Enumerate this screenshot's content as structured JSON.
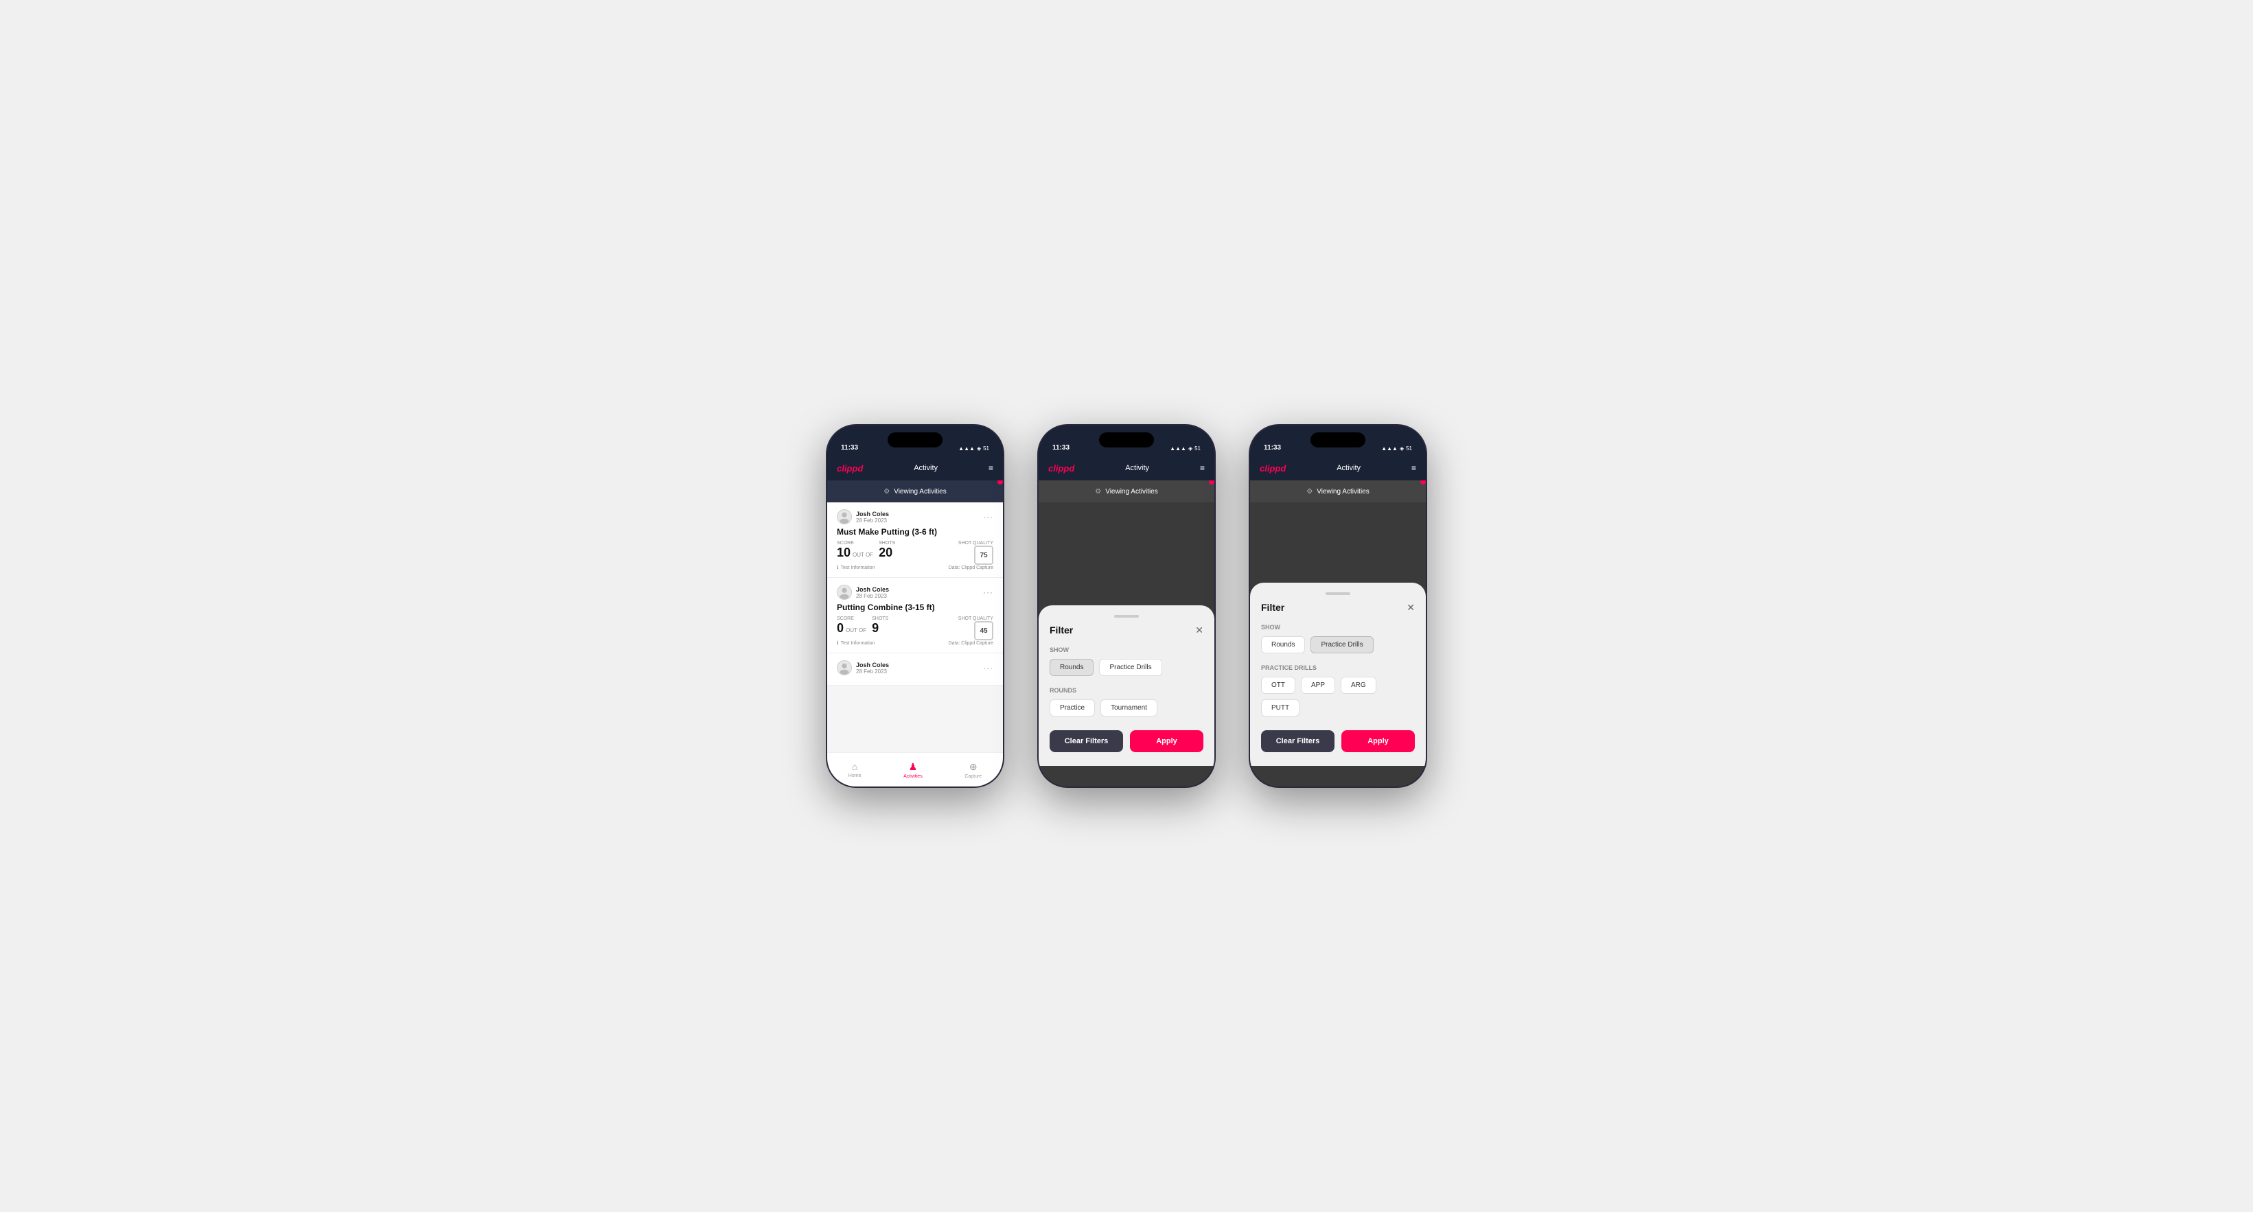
{
  "phones": [
    {
      "id": "phone1",
      "statusBar": {
        "time": "11:33",
        "battery": "51",
        "icons": "▲ ▼ ▲"
      },
      "header": {
        "logo": "clippd",
        "title": "Activity",
        "menuIcon": "≡"
      },
      "banner": {
        "icon": "⚙",
        "text": "Viewing Activities"
      },
      "activities": [
        {
          "userName": "Josh Coles",
          "date": "28 Feb 2023",
          "title": "Must Make Putting (3-6 ft)",
          "scoreLabel": "Score",
          "scoreValue": "10",
          "outOfLabel": "OUT OF",
          "totalShots": "20",
          "shotsLabel": "Shots",
          "shotQualityLabel": "Shot Quality",
          "shotQualityValue": "75",
          "info": "Test Information",
          "dataSource": "Data: Clippd Capture"
        },
        {
          "userName": "Josh Coles",
          "date": "28 Feb 2023",
          "title": "Putting Combine (3-15 ft)",
          "scoreLabel": "Score",
          "scoreValue": "0",
          "outOfLabel": "OUT OF",
          "totalShots": "9",
          "shotsLabel": "Shots",
          "shotQualityLabel": "Shot Quality",
          "shotQualityValue": "45",
          "info": "Test Information",
          "dataSource": "Data: Clippd Capture"
        },
        {
          "userName": "Josh Coles",
          "date": "28 Feb 2023",
          "title": "",
          "scoreLabel": "",
          "scoreValue": "",
          "outOfLabel": "",
          "totalShots": "",
          "shotsLabel": "",
          "shotQualityLabel": "",
          "shotQualityValue": "",
          "info": "",
          "dataSource": ""
        }
      ],
      "bottomNav": [
        {
          "icon": "⌂",
          "label": "Home",
          "active": false
        },
        {
          "icon": "♟",
          "label": "Activities",
          "active": true
        },
        {
          "icon": "⊕",
          "label": "Capture",
          "active": false
        }
      ]
    },
    {
      "id": "phone2",
      "statusBar": {
        "time": "11:33",
        "battery": "51"
      },
      "header": {
        "logo": "clippd",
        "title": "Activity",
        "menuIcon": "≡"
      },
      "banner": {
        "icon": "⚙",
        "text": "Viewing Activities"
      },
      "filter": {
        "title": "Filter",
        "showLabel": "Show",
        "showButtons": [
          {
            "label": "Rounds",
            "active": true
          },
          {
            "label": "Practice Drills",
            "active": false
          }
        ],
        "roundsLabel": "Rounds",
        "roundsButtons": [
          {
            "label": "Practice",
            "active": false
          },
          {
            "label": "Tournament",
            "active": false
          }
        ],
        "clearLabel": "Clear Filters",
        "applyLabel": "Apply"
      }
    },
    {
      "id": "phone3",
      "statusBar": {
        "time": "11:33",
        "battery": "51"
      },
      "header": {
        "logo": "clippd",
        "title": "Activity",
        "menuIcon": "≡"
      },
      "banner": {
        "icon": "⚙",
        "text": "Viewing Activities"
      },
      "filter": {
        "title": "Filter",
        "showLabel": "Show",
        "showButtons": [
          {
            "label": "Rounds",
            "active": false
          },
          {
            "label": "Practice Drills",
            "active": true
          }
        ],
        "practiceLabel": "Practice Drills",
        "practiceButtons": [
          {
            "label": "OTT",
            "active": false
          },
          {
            "label": "APP",
            "active": false
          },
          {
            "label": "ARG",
            "active": false
          },
          {
            "label": "PUTT",
            "active": false
          }
        ],
        "clearLabel": "Clear Filters",
        "applyLabel": "Apply"
      }
    }
  ]
}
